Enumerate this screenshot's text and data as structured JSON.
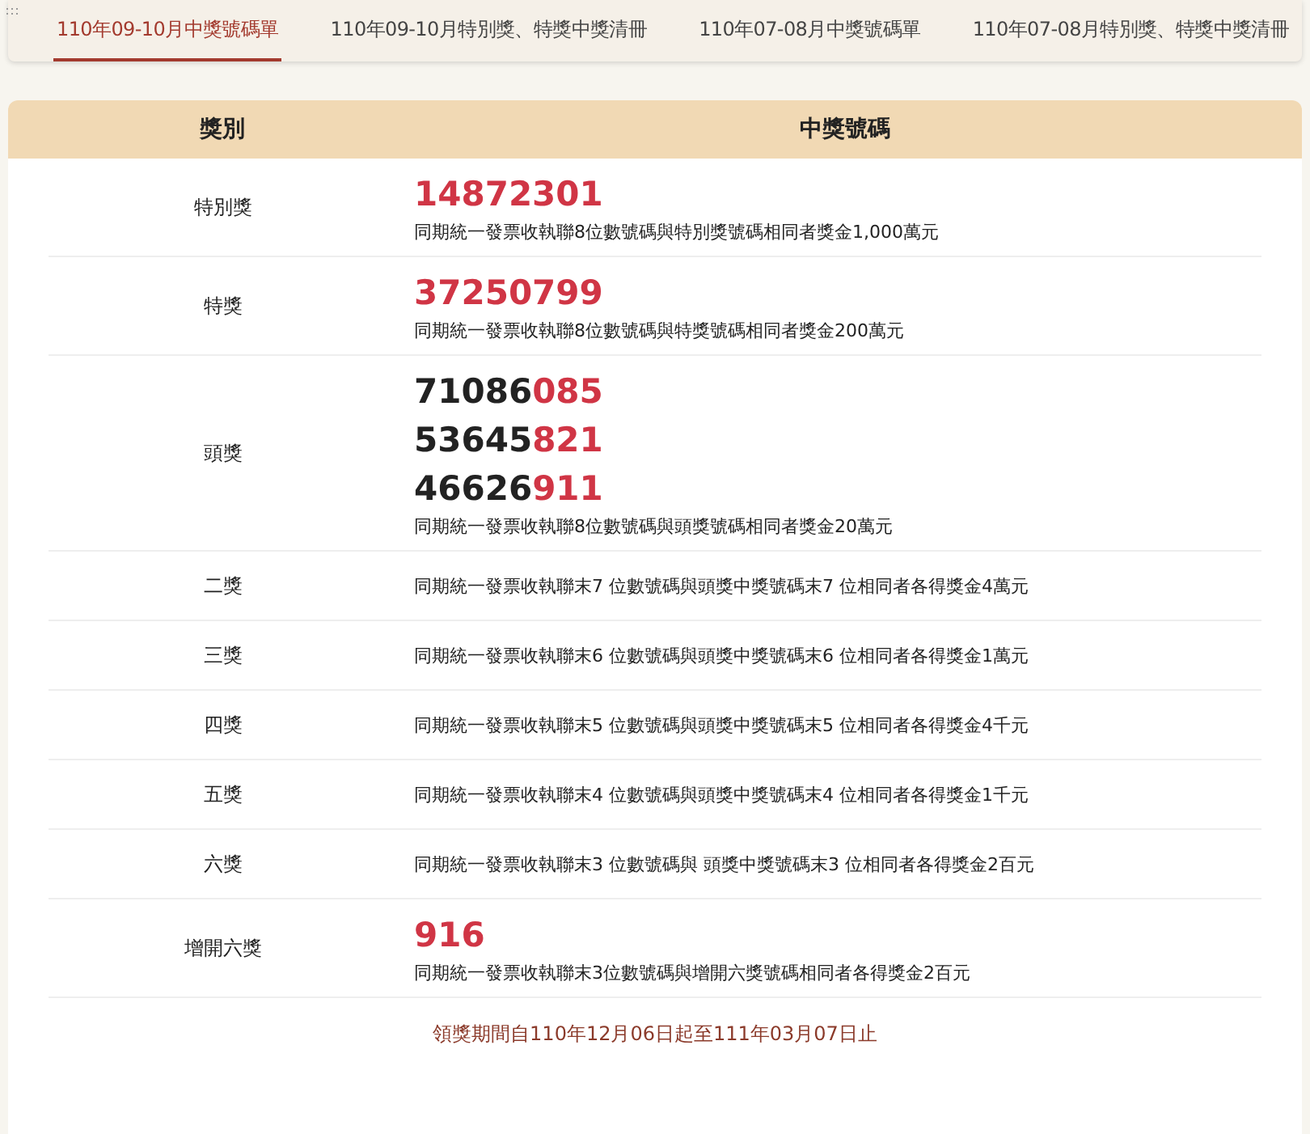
{
  "tabs": [
    {
      "label": "110年09-10月中獎號碼單",
      "selected": true
    },
    {
      "label": "110年09-10月特別獎、特獎中獎清冊",
      "selected": false
    },
    {
      "label": "110年07-08月中獎號碼單",
      "selected": false
    },
    {
      "label": "110年07-08月特別獎、特獎中獎清冊",
      "selected": false
    }
  ],
  "table": {
    "columns": [
      "獎別",
      "中獎號碼"
    ],
    "rows": [
      {
        "prize": "特別獎",
        "numbers": [
          {
            "tail": "14872301"
          }
        ],
        "description": "同期統一發票收執聯8位數號碼與特別獎號碼相同者獎金1,000萬元"
      },
      {
        "prize": "特獎",
        "numbers": [
          {
            "tail": "37250799"
          }
        ],
        "description": "同期統一發票收執聯8位數號碼與特獎號碼相同者獎金200萬元"
      },
      {
        "prize": "頭獎",
        "numbers": [
          {
            "lead": "71086",
            "tail": "085"
          },
          {
            "lead": "53645",
            "tail": "821"
          },
          {
            "lead": "46626",
            "tail": "911"
          }
        ],
        "description": "同期統一發票收執聯8位數號碼與頭獎號碼相同者獎金20萬元"
      },
      {
        "prize": "二獎",
        "description": "同期統一發票收執聯末7 位數號碼與頭獎中獎號碼末7 位相同者各得獎金4萬元"
      },
      {
        "prize": "三獎",
        "description": "同期統一發票收執聯末6 位數號碼與頭獎中獎號碼末6 位相同者各得獎金1萬元"
      },
      {
        "prize": "四獎",
        "description": "同期統一發票收執聯末5 位數號碼與頭獎中獎號碼末5 位相同者各得獎金4千元"
      },
      {
        "prize": "五獎",
        "description": "同期統一發票收執聯末4 位數號碼與頭獎中獎號碼末4 位相同者各得獎金1千元"
      },
      {
        "prize": "六獎",
        "description": "同期統一發票收執聯末3 位數號碼與 頭獎中獎號碼末3 位相同者各得獎金2百元"
      },
      {
        "prize": "增開六獎",
        "numbers": [
          {
            "tail": "916"
          }
        ],
        "description": "同期統一發票收執聯末3位數號碼與增開六獎號碼相同者各得獎金2百元"
      }
    ],
    "footer": "領獎期間自110年12月06日起至111年03月07日止"
  }
}
